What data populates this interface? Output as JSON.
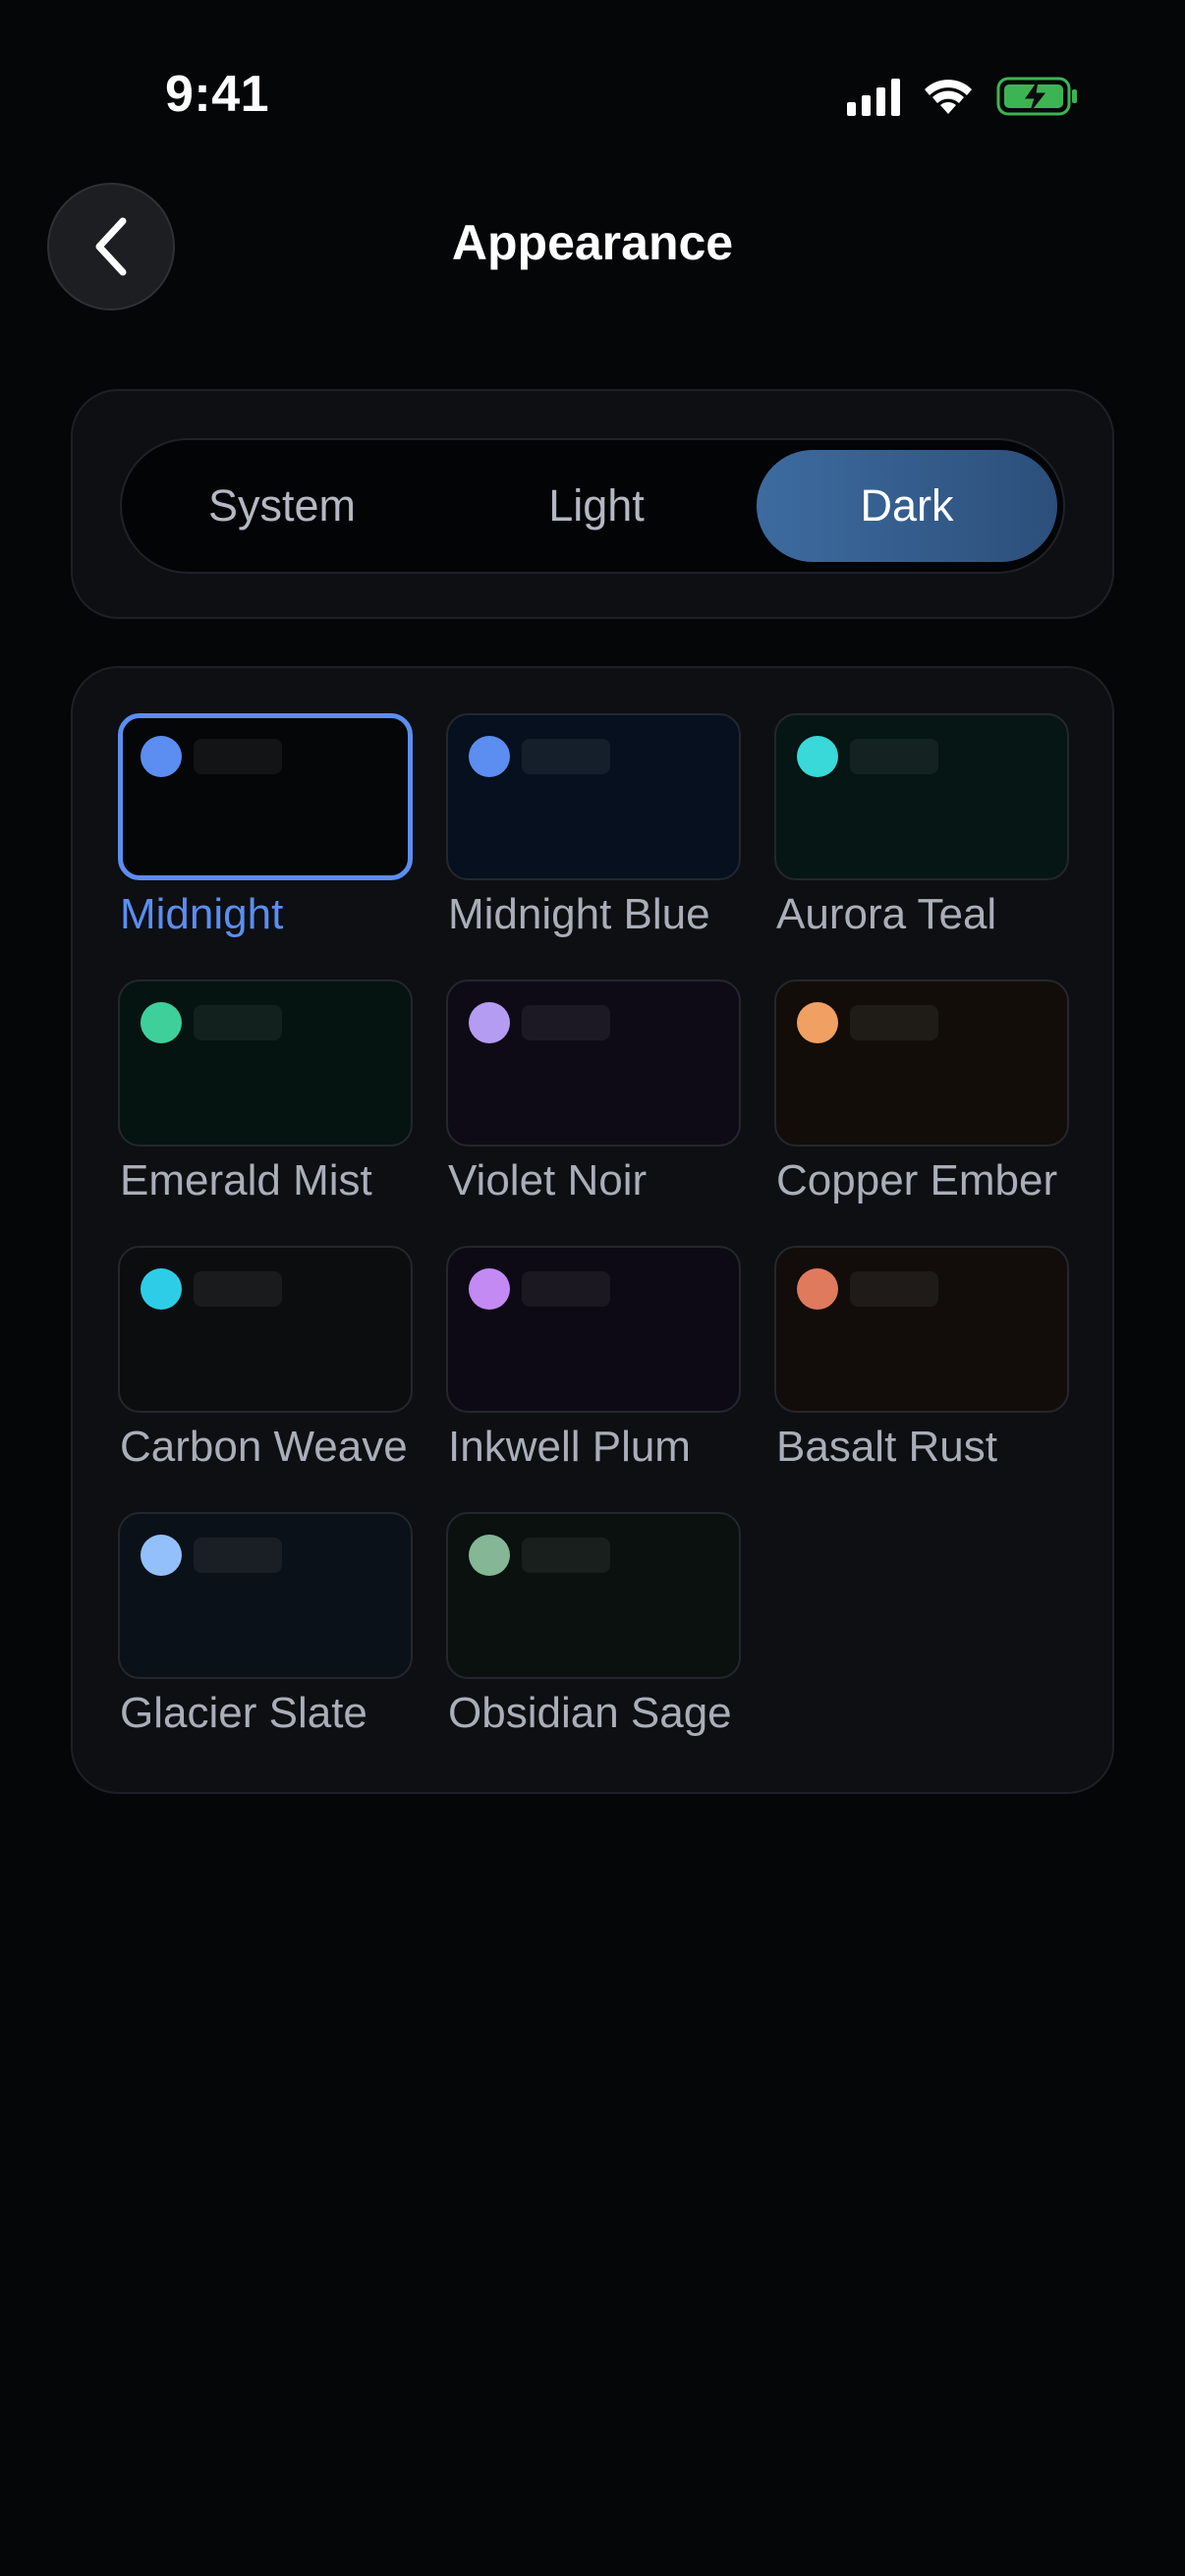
{
  "status_bar": {
    "time": "9:41"
  },
  "header": {
    "title": "Appearance",
    "back_icon": "chevron-left-icon"
  },
  "mode": {
    "options": [
      "System",
      "Light",
      "Dark"
    ],
    "selected": "Dark"
  },
  "themes": {
    "selected": "Midnight",
    "items": [
      {
        "label": "Midnight",
        "accent": "#5b8ef0",
        "background": "#050608"
      },
      {
        "label": "Midnight Blue",
        "accent": "#5b8ef0",
        "background": "#07101e"
      },
      {
        "label": "Aurora Teal",
        "accent": "#3ad9d9",
        "background": "#061614"
      },
      {
        "label": "Emerald Mist",
        "accent": "#3ecf9b",
        "background": "#051410"
      },
      {
        "label": "Violet Noir",
        "accent": "#b59cf3",
        "background": "#0e0b17"
      },
      {
        "label": "Copper Ember",
        "accent": "#f0a062",
        "background": "#120d09"
      },
      {
        "label": "Carbon Weave",
        "accent": "#2dcde8",
        "background": "#0c0d0f"
      },
      {
        "label": "Inkwell Plum",
        "accent": "#c38af3",
        "background": "#0d0a15"
      },
      {
        "label": "Basalt Rust",
        "accent": "#e07a5c",
        "background": "#120d0a"
      },
      {
        "label": "Glacier Slate",
        "accent": "#93c0fa",
        "background": "#0b1118"
      },
      {
        "label": "Obsidian Sage",
        "accent": "#85b696",
        "background": "#0a110e"
      }
    ]
  }
}
